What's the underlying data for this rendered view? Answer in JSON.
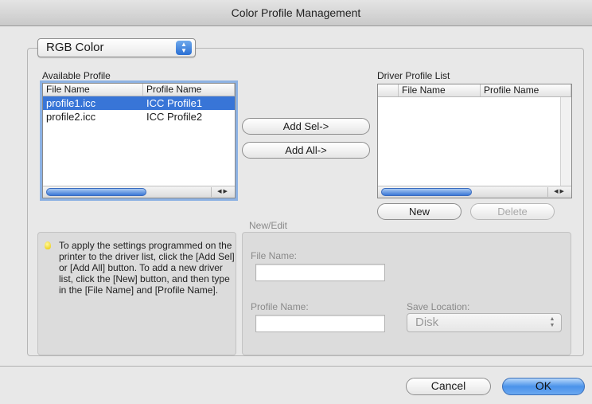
{
  "window": {
    "title": "Color Profile Management"
  },
  "color_mode": {
    "selected": "RGB Color",
    "stepper_icon": "updown-arrows-icon"
  },
  "available": {
    "label": "Available Profile",
    "columns": [
      "File Name",
      "Profile Name"
    ],
    "rows": [
      {
        "file": "profile1.icc",
        "profile": "ICC Profile1",
        "selected": true
      },
      {
        "file": "profile2.icc",
        "profile": "ICC Profile2",
        "selected": false
      }
    ]
  },
  "driver": {
    "label": "Driver Profile List",
    "columns": [
      "File Name",
      "Profile Name"
    ]
  },
  "buttons": {
    "add_sel": "Add Sel->",
    "add_all": "Add All->",
    "new": "New",
    "delete": "Delete",
    "cancel": "Cancel",
    "ok": "OK"
  },
  "info": {
    "icon": "lightbulb-icon",
    "text": "To apply the settings programmed on the printer to the driver list, click the [Add Sel] or [Add All] button. To add a new driver list, click the [New] button, and then type in the [File Name] and [Profile Name]."
  },
  "edit": {
    "section_label": "New/Edit",
    "file_name_label": "File Name:",
    "file_name_value": "",
    "profile_name_label": "Profile Name:",
    "profile_name_value": "",
    "save_location_label": "Save Location:",
    "save_location_value": "Disk"
  },
  "colors": {
    "accent": "#3875d7",
    "focus_ring": "#8db2e3"
  }
}
